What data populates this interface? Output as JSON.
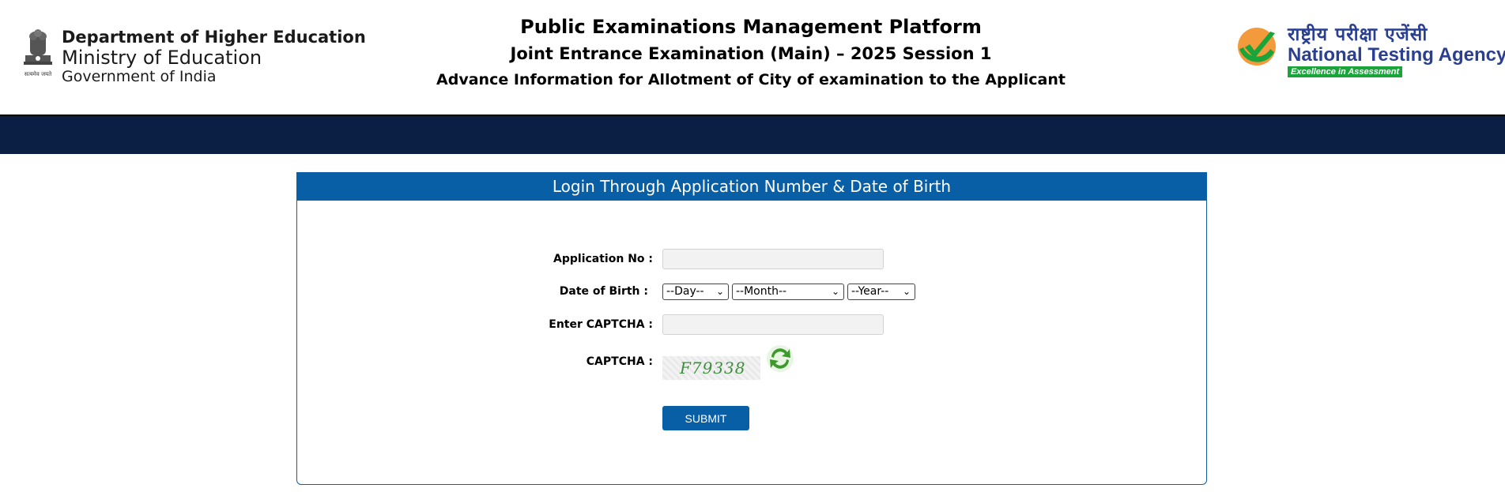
{
  "header": {
    "ministry": {
      "line1": "Department of Higher Education",
      "line2": "Ministry of Education",
      "line3": "Government of India",
      "motto": "सत्यमेव जयते"
    },
    "title": "Public Examinations Management Platform",
    "subtitle": "Joint Entrance Examination (Main) – 2025 Session 1",
    "notice": "Advance Information for Allotment of City of examination to the Applicant",
    "agency": {
      "hindi": "राष्ट्रीय परीक्षा एजेंसी",
      "name": "National Testing Agency",
      "tagline": "Excellence in Assessment"
    }
  },
  "form": {
    "heading": "Login Through Application Number & Date of Birth",
    "application_label": "Application No :",
    "application_value": "",
    "dob_label": "Date of Birth :",
    "day_selected": "--Day--",
    "month_selected": "--Month--",
    "year_selected": "--Year--",
    "captcha_input_label": "Enter CAPTCHA :",
    "captcha_input_value": "",
    "captcha_label": "CAPTCHA :",
    "captcha_text": "F79338",
    "submit_label": "SUBMIT"
  },
  "colors": {
    "brand_blue": "#085fa5",
    "navbar": "#0b1f44",
    "agency_green": "#1aa53a"
  },
  "icons": {
    "emblem": "national-emblem-icon",
    "nta_logo": "nta-check-logo-icon",
    "refresh": "refresh-captcha-icon",
    "dropdown": "chevron-down-icon"
  }
}
